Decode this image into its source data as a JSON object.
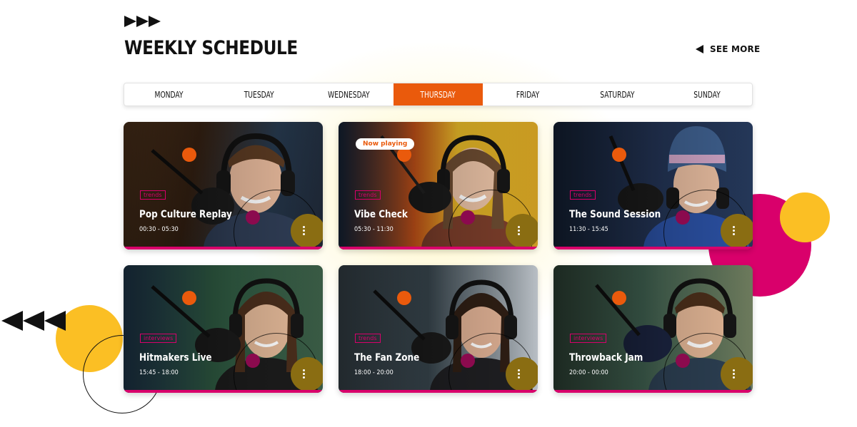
{
  "header": {
    "title": "WEEKLY SCHEDULE",
    "see_more": "SEE MORE"
  },
  "tabs": [
    "MONDAY",
    "TUESDAY",
    "WEDNESDAY",
    "THURSDAY",
    "FRIDAY",
    "SATURDAY",
    "SUNDAY"
  ],
  "active_tab": "THURSDAY",
  "now_playing": "Now playing",
  "shows": [
    {
      "name": "Pop Culture Replay",
      "time": "00:30 - 05:30",
      "tag": "trends",
      "now_playing": false
    },
    {
      "name": "Vibe Check",
      "time": "05:30 - 11:30",
      "tag": "trends",
      "now_playing": true
    },
    {
      "name": "The Sound Session",
      "time": "11:30 - 15:45",
      "tag": "trends",
      "now_playing": false
    },
    {
      "name": "Hitmakers Live",
      "time": "15:45 - 18:00",
      "tag": "interviews",
      "now_playing": false
    },
    {
      "name": "The Fan Zone",
      "time": "18:00 - 20:00",
      "tag": "trends",
      "now_playing": false
    },
    {
      "name": "Throwback Jam",
      "time": "20:00 - 00:00",
      "tag": "interviews",
      "now_playing": false
    }
  ],
  "icons": {
    "header": "fast-forward-arrows-icon",
    "see_more": "triangle-left-icon",
    "card_menu": "vertical-dots-icon",
    "decor": "rewind-arrows-icon"
  },
  "colors": {
    "accent": "#ea5a0c",
    "pink": "#d9006b",
    "yellow": "#fbbf24",
    "menu_button": "#8a6d12"
  }
}
